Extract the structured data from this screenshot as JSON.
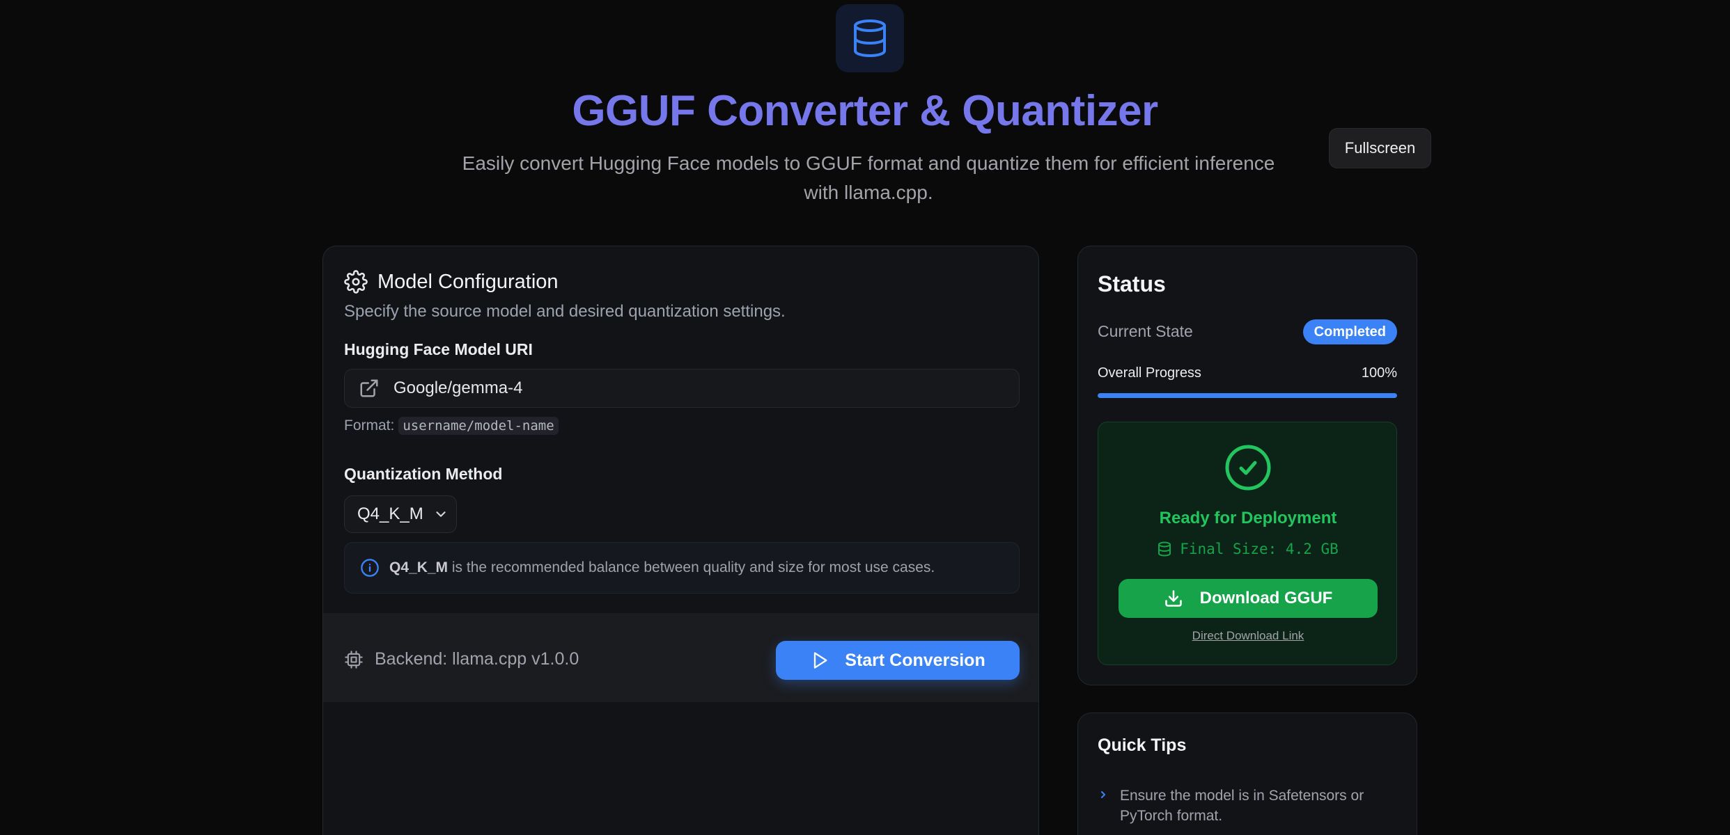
{
  "header": {
    "title": "GGUF Converter & Quantizer",
    "subtitle": "Easily convert Hugging Face models to GGUF format and quantize them for efficient inference with llama.cpp.",
    "fullscreen_label": "Fullscreen",
    "logo_icon": "database-icon"
  },
  "config": {
    "title": "Model Configuration",
    "description": "Specify the source model and desired quantization settings.",
    "uri_label": "Hugging Face Model URI",
    "uri_value": "Google/gemma-4",
    "format_prefix": "Format:",
    "format_code": "username/model-name",
    "quant_label": "Quantization Method",
    "quant_value": "Q4_K_M",
    "info_strong": "Q4_K_M",
    "info_text": " is the recommended balance between quality and size for most use cases.",
    "backend": "Backend: llama.cpp v1.0.0",
    "start_label": "Start Conversion"
  },
  "status": {
    "title": "Status",
    "state_label": "Current State",
    "state_value": "Completed",
    "progress_label": "Overall Progress",
    "progress_value": "100%",
    "progress_fraction": 1.0,
    "ready_text": "Ready for Deployment",
    "final_size": "Final Size: 4.2 GB",
    "download_label": "Download GGUF",
    "direct_link": "Direct Download Link"
  },
  "tips": {
    "title": "Quick Tips",
    "items": [
      "Ensure the model is in Safetensors or PyTorch format."
    ]
  },
  "colors": {
    "accent_blue": "#3b82f6",
    "success_green": "#22c55e",
    "title_purple": "#7577ea"
  }
}
